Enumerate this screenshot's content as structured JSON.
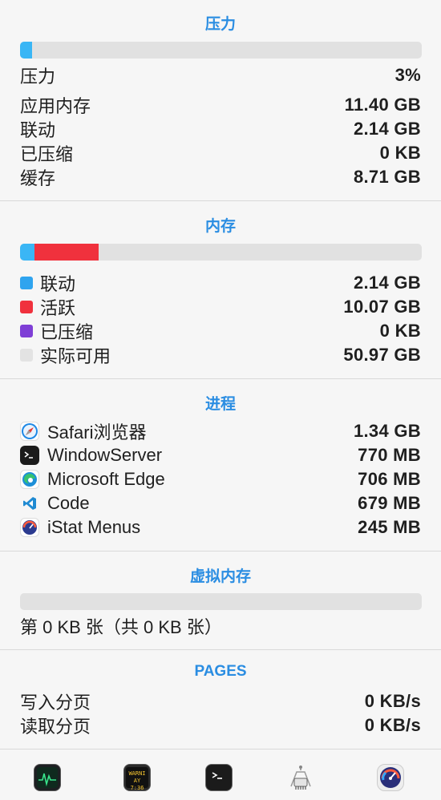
{
  "pressure": {
    "title": "压力",
    "bar": {
      "pressure_fraction": 0.03,
      "color": "#3ab6f5"
    },
    "rows": [
      {
        "label": "压力",
        "value": "3%"
      },
      {
        "label": "应用内存",
        "value": "11.40 GB"
      },
      {
        "label": "联动",
        "value": "2.14 GB"
      },
      {
        "label": "已压缩",
        "value": "0 KB"
      },
      {
        "label": "缓存",
        "value": "8.71 GB"
      }
    ]
  },
  "memory": {
    "title": "内存",
    "bar": {
      "wired_fraction": 0.035,
      "wired_color": "#3ab6f5",
      "active_fraction": 0.16,
      "active_color": "#f0313d"
    },
    "rows": [
      {
        "label": "联动",
        "value": "2.14 GB",
        "color": "#2fa4ef"
      },
      {
        "label": "活跃",
        "value": "10.07 GB",
        "color": "#f0313d"
      },
      {
        "label": "已压缩",
        "value": "0 KB",
        "color": "#7f3fd6"
      },
      {
        "label": "实际可用",
        "value": "50.97 GB",
        "color": "#e3e3e3"
      }
    ]
  },
  "processes": {
    "title": "进程",
    "items": [
      {
        "name": "Safari浏览器",
        "value": "1.34 GB",
        "icon": "safari-icon"
      },
      {
        "name": "WindowServer",
        "value": "770 MB",
        "icon": "terminal-icon"
      },
      {
        "name": "Microsoft Edge",
        "value": "706 MB",
        "icon": "edge-icon"
      },
      {
        "name": "Code",
        "value": "679 MB",
        "icon": "vscode-icon"
      },
      {
        "name": "iStat Menus",
        "value": "245 MB",
        "icon": "istat-icon"
      }
    ]
  },
  "virtual_memory": {
    "title": "虚拟内存",
    "bar": {
      "fraction": 0.0
    },
    "summary": "第 0 KB 张（共 0 KB 张）"
  },
  "pages": {
    "title": "PAGES",
    "rows": [
      {
        "label": "写入分页",
        "value": "0 KB/s"
      },
      {
        "label": "读取分页",
        "value": "0 KB/s"
      }
    ]
  },
  "dock": {
    "items": [
      {
        "name": "activity-monitor-icon"
      },
      {
        "name": "console-icon",
        "text_line1": "WARNI",
        "text_line2": "AY 7:36"
      },
      {
        "name": "terminal-icon"
      },
      {
        "name": "system-information-icon"
      },
      {
        "name": "istat-menus-icon"
      }
    ]
  }
}
